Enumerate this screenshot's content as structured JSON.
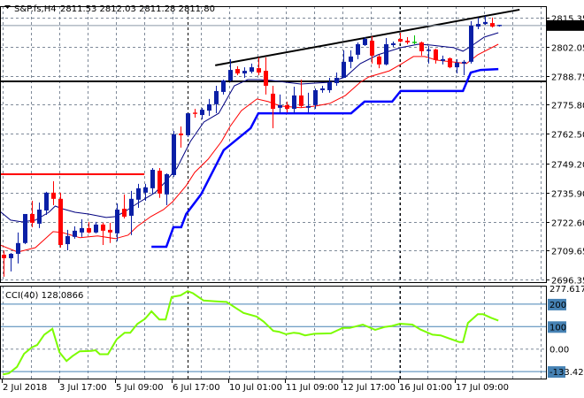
{
  "header": {
    "menu_icon": "triangle-down-icon",
    "symbol": "S&P.fs,H4",
    "ohlc": "2811.53 2812.03 2811.28 2811.80"
  },
  "colors": {
    "bull": "#0a1fa6",
    "bear": "#ff0000",
    "doji": "#00c000",
    "ma_fast": "#000080",
    "ma_slow": "#ff0000",
    "stop_line": "#0000ff",
    "cci": "#7cfc00",
    "level": "#4682b4",
    "grid": "#7f8a99"
  },
  "chart_data": [
    {
      "type": "candlestick",
      "title": "S&P.fs,H4",
      "current_price_label": "2811.80",
      "current_price": 2811.8,
      "ylim": [
        2696.35,
        2815.35
      ],
      "y_ticks": [
        "2815.35",
        "2802.05",
        "2788.75",
        "2775.80",
        "2762.50",
        "2749.20",
        "2735.90",
        "2722.60",
        "2709.65",
        "2696.35"
      ],
      "x_ticks": [
        {
          "index": 0,
          "label": "2 Jul 2018"
        },
        {
          "index": 8,
          "label": "3 Jul 17:00"
        },
        {
          "index": 16,
          "label": "5 Jul 09:00"
        },
        {
          "index": 24,
          "label": "6 Jul 17:00"
        },
        {
          "index": 32,
          "label": "10 Jul 01:00"
        },
        {
          "index": 40,
          "label": "11 Jul 09:00"
        },
        {
          "index": 48,
          "label": "12 Jul 17:00"
        },
        {
          "index": 56,
          "label": "16 Jul 01:00"
        },
        {
          "index": 64,
          "label": "17 Jul 09:00"
        }
      ],
      "period_separators": [
        26,
        56
      ],
      "candles": [
        [
          2707.6,
          2709.6,
          2697.6,
          2706.0
        ],
        [
          2706.0,
          2708.4,
          2700.0,
          2708.0
        ],
        [
          2708.0,
          2717.7,
          2703.6,
          2712.9
        ],
        [
          2712.9,
          2726.1,
          2712.4,
          2726.1
        ],
        [
          2726.1,
          2732.1,
          2720.1,
          2722.1
        ],
        [
          2721.7,
          2731.3,
          2719.7,
          2728.1
        ],
        [
          2727.7,
          2736.2,
          2725.7,
          2735.8
        ],
        [
          2735.8,
          2741.0,
          2730.1,
          2733.0
        ],
        [
          2733.0,
          2735.8,
          2710.8,
          2712.0
        ],
        [
          2712.4,
          2718.9,
          2709.6,
          2716.1
        ],
        [
          2715.7,
          2720.5,
          2714.9,
          2718.5
        ],
        [
          2717.7,
          2723.7,
          2715.7,
          2719.7
        ],
        [
          2719.7,
          2722.5,
          2717.3,
          2717.7
        ],
        [
          2717.7,
          2722.5,
          2717.3,
          2721.3
        ],
        [
          2721.3,
          2722.1,
          2712.0,
          2718.5
        ],
        [
          2718.9,
          2722.1,
          2712.9,
          2717.7
        ],
        [
          2717.3,
          2730.9,
          2713.7,
          2728.1
        ],
        [
          2728.5,
          2735.0,
          2724.1,
          2724.9
        ],
        [
          2725.3,
          2736.6,
          2716.5,
          2733.0
        ],
        [
          2732.6,
          2739.8,
          2728.9,
          2737.8
        ],
        [
          2735.8,
          2739.8,
          2732.1,
          2738.2
        ],
        [
          2737.8,
          2747.0,
          2735.0,
          2746.2
        ],
        [
          2745.8,
          2747.0,
          2733.4,
          2735.4
        ],
        [
          2735.0,
          2744.6,
          2730.1,
          2744.2
        ],
        [
          2743.8,
          2763.9,
          2743.0,
          2762.3
        ],
        [
          2762.7,
          2765.9,
          2756.3,
          2761.9
        ],
        [
          2761.9,
          2771.9,
          2761.1,
          2771.9
        ],
        [
          2771.9,
          2773.9,
          2769.9,
          2771.5
        ],
        [
          2771.1,
          2774.4,
          2769.1,
          2773.5
        ],
        [
          2773.1,
          2778.4,
          2770.7,
          2776.0
        ],
        [
          2776.0,
          2784.4,
          2771.9,
          2782.0
        ],
        [
          2781.6,
          2787.2,
          2780.4,
          2786.8
        ],
        [
          2786.8,
          2796.5,
          2786.4,
          2791.6
        ],
        [
          2792.0,
          2793.3,
          2789.2,
          2790.0
        ],
        [
          2790.0,
          2792.8,
          2788.0,
          2791.2
        ],
        [
          2790.8,
          2794.5,
          2790.0,
          2792.8
        ],
        [
          2792.4,
          2797.3,
          2789.2,
          2790.4
        ],
        [
          2791.2,
          2797.3,
          2780.4,
          2784.4
        ],
        [
          2780.8,
          2784.4,
          2765.1,
          2773.9
        ],
        [
          2774.4,
          2780.4,
          2771.9,
          2775.6
        ],
        [
          2775.6,
          2777.2,
          2772.3,
          2773.9
        ],
        [
          2773.9,
          2784.0,
          2771.9,
          2780.0
        ],
        [
          2780.0,
          2787.2,
          2774.4,
          2775.2
        ],
        [
          2774.4,
          2781.2,
          2772.3,
          2775.2
        ],
        [
          2775.6,
          2783.2,
          2773.9,
          2782.4
        ],
        [
          2782.4,
          2784.4,
          2781.2,
          2783.2
        ],
        [
          2782.4,
          2788.0,
          2781.2,
          2786.0
        ],
        [
          2785.6,
          2790.4,
          2784.4,
          2788.0
        ],
        [
          2788.0,
          2800.5,
          2788.0,
          2795.3
        ],
        [
          2795.3,
          2800.5,
          2792.4,
          2797.7
        ],
        [
          2798.5,
          2804.1,
          2796.5,
          2803.3
        ],
        [
          2802.9,
          2806.5,
          2802.5,
          2805.7
        ],
        [
          2804.9,
          2806.9,
          2794.5,
          2798.1
        ],
        [
          2797.7,
          2798.5,
          2792.4,
          2794.1
        ],
        [
          2794.1,
          2806.1,
          2793.7,
          2803.3
        ],
        [
          2802.9,
          2804.5,
          2802.1,
          2803.7
        ],
        [
          2805.7,
          2808.5,
          2804.1,
          2804.5
        ],
        [
          2804.9,
          2806.5,
          2803.3,
          2804.1
        ],
        [
          2804.1,
          2807.3,
          2803.3,
          2804.1
        ],
        [
          2804.1,
          2804.5,
          2798.1,
          2800.1
        ],
        [
          2800.1,
          2802.5,
          2794.5,
          2800.5
        ],
        [
          2800.9,
          2801.3,
          2794.5,
          2796.1
        ],
        [
          2795.7,
          2798.1,
          2794.1,
          2796.5
        ],
        [
          2796.9,
          2797.3,
          2792.4,
          2792.8
        ],
        [
          2792.8,
          2796.5,
          2790.0,
          2794.9
        ],
        [
          2794.5,
          2796.1,
          2789.2,
          2795.3
        ],
        [
          2795.3,
          2813.8,
          2794.5,
          2811.7
        ],
        [
          2811.3,
          2815.4,
          2810.1,
          2812.5
        ],
        [
          2812.5,
          2816.2,
          2812.1,
          2813.4
        ],
        [
          2812.9,
          2815.4,
          2810.9,
          2811.3
        ],
        [
          2811.53,
          2812.03,
          2811.28,
          2811.8
        ]
      ],
      "series": [
        {
          "name": "ma_fast",
          "points": [
            [
              -0.5,
              2727.3
            ],
            [
              1,
              2723.3
            ],
            [
              2.6,
              2722.5
            ],
            [
              4.5,
              2723.3
            ],
            [
              6.4,
              2726.9
            ],
            [
              7.3,
              2729.7
            ],
            [
              8.3,
              2728.5
            ],
            [
              10.1,
              2726.9
            ],
            [
              12,
              2726.1
            ],
            [
              14.5,
              2724.5
            ],
            [
              15.8,
              2724.9
            ],
            [
              17,
              2726.9
            ],
            [
              18.9,
              2730.9
            ],
            [
              21.4,
              2735.8
            ],
            [
              22.6,
              2739.8
            ],
            [
              24.5,
              2747.0
            ],
            [
              26.4,
              2759.1
            ],
            [
              28.3,
              2767.9
            ],
            [
              30.4,
              2771.9
            ],
            [
              32.6,
              2784.4
            ],
            [
              34.5,
              2787.2
            ],
            [
              36.1,
              2787.2
            ],
            [
              37.9,
              2786.8
            ],
            [
              39.9,
              2786.0
            ],
            [
              42,
              2785.2
            ],
            [
              46.1,
              2786.0
            ],
            [
              48.3,
              2788.4
            ],
            [
              50.4,
              2794.5
            ],
            [
              52.9,
              2798.5
            ],
            [
              56.1,
              2801.7
            ],
            [
              58.6,
              2803.3
            ],
            [
              60.4,
              2802.9
            ],
            [
              63.6,
              2801.7
            ],
            [
              64.9,
              2800.1
            ],
            [
              66.1,
              2802.5
            ],
            [
              67.9,
              2806.5
            ],
            [
              69.9,
              2808.5
            ]
          ]
        },
        {
          "name": "ma_slow",
          "points": [
            [
              -0.5,
              2712.0
            ],
            [
              2,
              2708.8
            ],
            [
              4.5,
              2710.8
            ],
            [
              7,
              2718.1
            ],
            [
              8.3,
              2717.7
            ],
            [
              10.8,
              2715.3
            ],
            [
              13.3,
              2716.1
            ],
            [
              15.8,
              2714.9
            ],
            [
              17.6,
              2716.5
            ],
            [
              18.9,
              2720.5
            ],
            [
              20.8,
              2724.9
            ],
            [
              22.6,
              2728.1
            ],
            [
              23.9,
              2731.7
            ],
            [
              25.8,
              2739.0
            ],
            [
              27,
              2745.0
            ],
            [
              28.9,
              2751.0
            ],
            [
              30.8,
              2759.1
            ],
            [
              32,
              2765.9
            ],
            [
              33.6,
              2773.1
            ],
            [
              35.8,
              2778.4
            ],
            [
              37.4,
              2777.2
            ],
            [
              39.1,
              2775.2
            ],
            [
              42,
              2774.4
            ],
            [
              44.1,
              2775.2
            ],
            [
              46.1,
              2776.4
            ],
            [
              48.3,
              2780.0
            ],
            [
              50.4,
              2786.0
            ],
            [
              51.6,
              2788.4
            ],
            [
              54.5,
              2791.2
            ],
            [
              56.1,
              2794.1
            ],
            [
              57.9,
              2797.7
            ],
            [
              59.5,
              2797.7
            ],
            [
              61.1,
              2796.1
            ],
            [
              63.3,
              2795.3
            ],
            [
              65.4,
              2794.5
            ],
            [
              67,
              2798.5
            ],
            [
              69.9,
              2803.3
            ]
          ]
        },
        {
          "name": "stop_line",
          "points": [
            [
              20.9,
              2711.2
            ],
            [
              23,
              2711.2
            ],
            [
              24,
              2720.1
            ],
            [
              25.1,
              2720.1
            ],
            [
              25.8,
              2726.1
            ],
            [
              27.9,
              2735.0
            ],
            [
              31.1,
              2755.1
            ],
            [
              34.9,
              2765.1
            ],
            [
              36,
              2771.9
            ],
            [
              49.1,
              2771.9
            ],
            [
              51,
              2777.2
            ],
            [
              54.9,
              2777.2
            ],
            [
              56.1,
              2782.0
            ],
            [
              64.9,
              2782.0
            ],
            [
              66,
              2790.4
            ],
            [
              67.4,
              2791.6
            ],
            [
              69.9,
              2792.0
            ]
          ]
        }
      ],
      "annotations": {
        "resistance_hline": 2786.4,
        "red_hline": {
          "price": 2744.2,
          "from": -0.5,
          "to": 19.9
        },
        "trendline": [
          [
            29.9,
            2793.7
          ],
          [
            72.9,
            2819.0
          ]
        ]
      }
    },
    {
      "type": "line",
      "title": "CCI(40) 128.0866",
      "ylim": [
        -133.4215,
        277.617
      ],
      "y_ticks": [
        "277.617",
        "200",
        "100",
        "0.00",
        "-133.4215"
      ],
      "levels": [
        200,
        100,
        -100
      ],
      "series": [
        {
          "name": "CCI(40)",
          "points": [
            [
              -0.1,
              -113
            ],
            [
              0.75,
              -108
            ],
            [
              1.9,
              -79
            ],
            [
              2.9,
              -21
            ],
            [
              4,
              8
            ],
            [
              4.75,
              18
            ],
            [
              5.75,
              64
            ],
            [
              6.9,
              90
            ],
            [
              7.9,
              -14
            ],
            [
              8.9,
              -53
            ],
            [
              9.75,
              -31
            ],
            [
              10.75,
              -10
            ],
            [
              12.4,
              -8
            ],
            [
              13,
              -5
            ],
            [
              13.6,
              -23
            ],
            [
              14.75,
              -23
            ],
            [
              16,
              44
            ],
            [
              17.1,
              73
            ],
            [
              17.9,
              73
            ],
            [
              18.9,
              112
            ],
            [
              20,
              135
            ],
            [
              20.9,
              168
            ],
            [
              22,
              132
            ],
            [
              22.9,
              132
            ],
            [
              23.75,
              232
            ],
            [
              25,
              239
            ],
            [
              26,
              258
            ],
            [
              26.75,
              249
            ],
            [
              28.25,
              216
            ],
            [
              29.75,
              213
            ],
            [
              31.5,
              210
            ],
            [
              32.9,
              181
            ],
            [
              33.9,
              161
            ],
            [
              35.75,
              145
            ],
            [
              36.75,
              122
            ],
            [
              38.1,
              81
            ],
            [
              38.9,
              77
            ],
            [
              39.9,
              66
            ],
            [
              41,
              73
            ],
            [
              41.75,
              70
            ],
            [
              42.6,
              61
            ],
            [
              43.9,
              68
            ],
            [
              46.25,
              70
            ],
            [
              47.9,
              94
            ],
            [
              48.9,
              94
            ],
            [
              50.75,
              109
            ],
            [
              52.5,
              86
            ],
            [
              53.9,
              99
            ],
            [
              54.9,
              103
            ],
            [
              56,
              113
            ],
            [
              57.75,
              109
            ],
            [
              58.9,
              87
            ],
            [
              60.6,
              64
            ],
            [
              61.75,
              61
            ],
            [
              63.25,
              44
            ],
            [
              64.4,
              31
            ],
            [
              64.9,
              31
            ],
            [
              65.6,
              116
            ],
            [
              67,
              155
            ],
            [
              67.75,
              155
            ],
            [
              68.9,
              139
            ],
            [
              69.9,
              127
            ]
          ]
        }
      ]
    }
  ]
}
